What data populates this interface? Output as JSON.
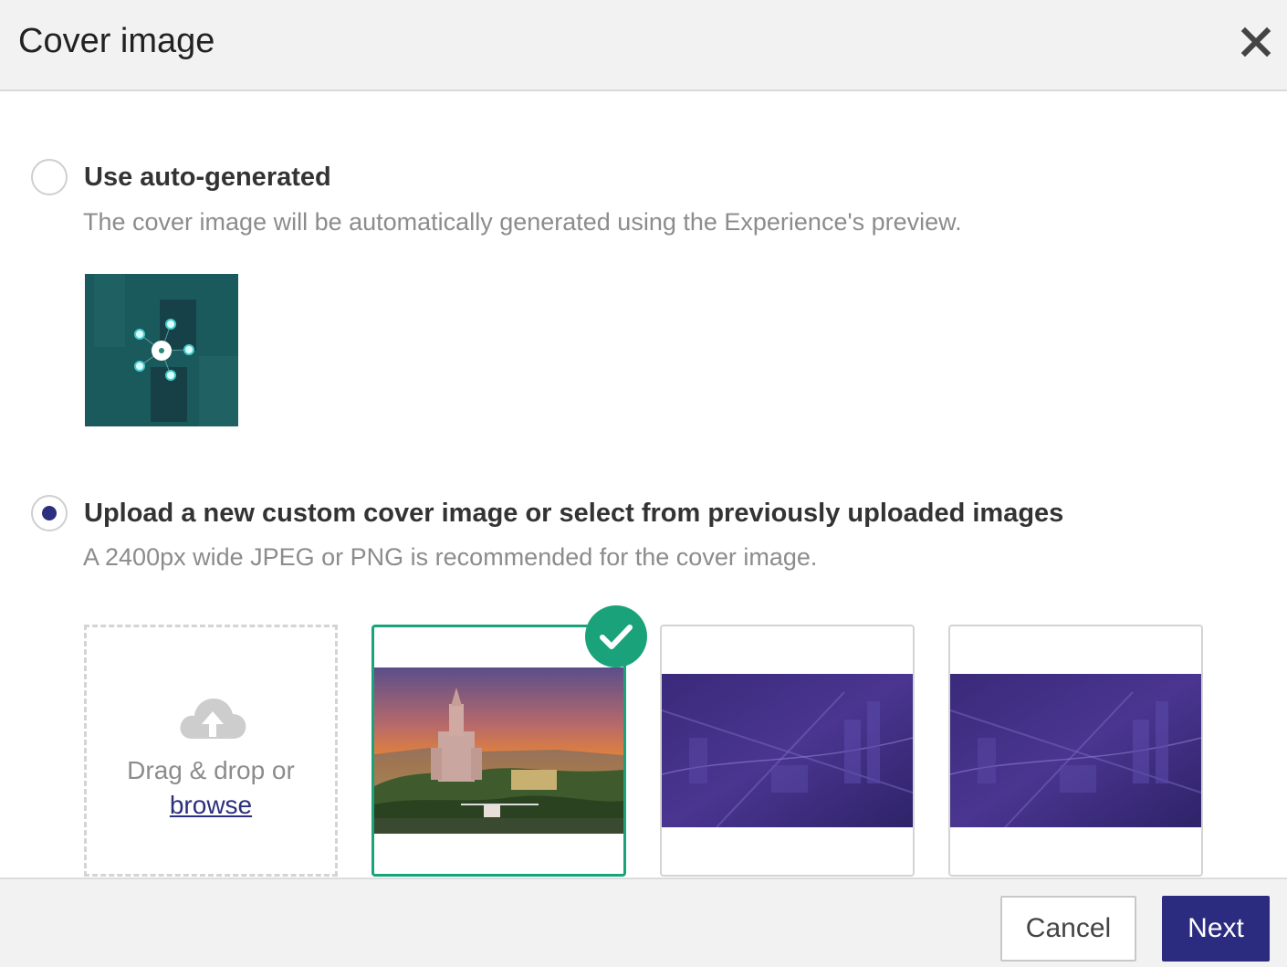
{
  "dialog": {
    "title": "Cover image",
    "close_icon": "close-icon"
  },
  "options": {
    "auto": {
      "label": "Use auto-generated",
      "description": "The cover image will be automatically generated using the Experience's preview.",
      "selected": false
    },
    "custom": {
      "label": "Upload a new custom cover image or select from previously uploaded images",
      "description": "A 2400px wide JPEG or PNG is recommended for the cover image.",
      "selected": true
    }
  },
  "dropzone": {
    "icon": "cloud-upload-icon",
    "text": "Drag & drop or",
    "browse_label": "browse"
  },
  "images": [
    {
      "name": "barcelona-sunset",
      "selected": true
    },
    {
      "name": "purple-city-1",
      "selected": false
    },
    {
      "name": "purple-city-2",
      "selected": false
    }
  ],
  "footer": {
    "cancel_label": "Cancel",
    "next_label": "Next"
  },
  "colors": {
    "accent": "#2b2c80",
    "selected": "#1aa37a",
    "header_bg": "#f2f2f2"
  }
}
